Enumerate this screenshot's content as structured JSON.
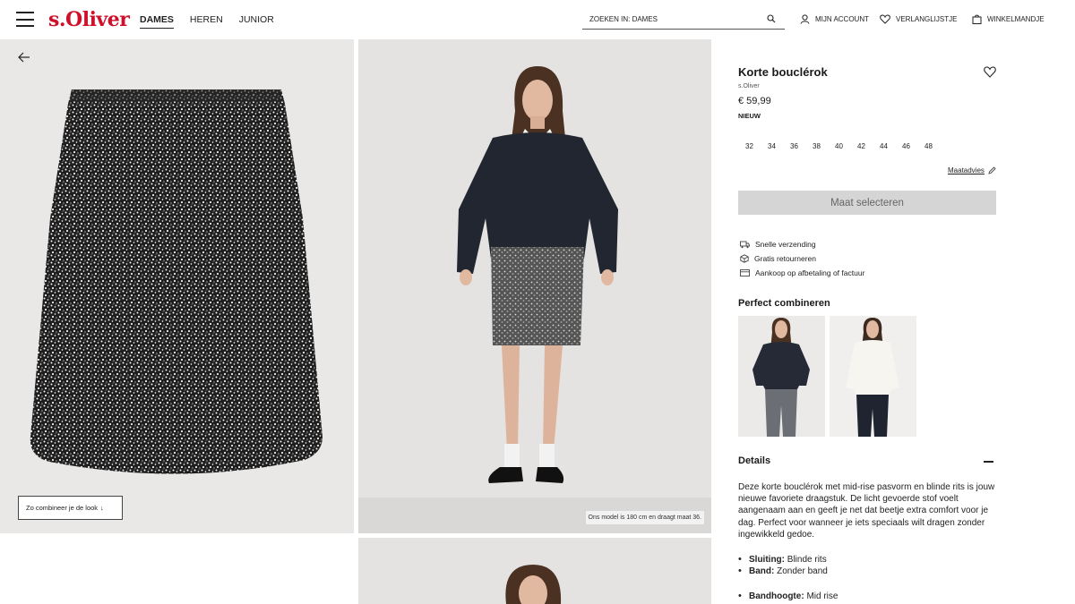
{
  "header": {
    "logo": "s.Oliver",
    "nav": [
      {
        "label": "DAMES",
        "active": true
      },
      {
        "label": "HEREN",
        "active": false
      },
      {
        "label": "JUNIOR",
        "active": false
      }
    ],
    "search_placeholder": "ZOEKEN IN: DAMES",
    "account_label": "MIJN ACCOUNT",
    "wishlist_label": "VERLANGLIJSTJE",
    "cart_label": "WINKELMANDJE"
  },
  "gallery": {
    "look_button": "Zo combineer je de look",
    "model_note": "Ons model is 180 cm en draagt maat 36."
  },
  "product": {
    "title": "Korte bouclérok",
    "brand": "s.Oliver",
    "price": "€ 59,99",
    "badge": "NIEUW",
    "sizes": [
      "32",
      "34",
      "36",
      "38",
      "40",
      "42",
      "44",
      "46",
      "48"
    ],
    "size_advice": "Maatadvies",
    "select_button": "Maat selecteren",
    "usps": [
      {
        "icon": "truck-icon",
        "label": "Snelle verzending"
      },
      {
        "icon": "box-icon",
        "label": "Gratis retourneren"
      },
      {
        "icon": "card-icon",
        "label": "Aankoop op afbetaling of factuur"
      }
    ]
  },
  "combine": {
    "title": "Perfect combineren"
  },
  "details": {
    "title": "Details",
    "description": "Deze korte bouclérok met mid-rise pasvorm en blinde rits is jouw nieuwe favoriete draagstuk. De licht gevoerde stof voelt aangenaam aan en geeft je net dat beetje extra comfort voor je dag. Perfect voor wanneer je iets speciaals wilt dragen zonder ingewikkeld gedoe.",
    "specs": [
      {
        "key": "Sluiting:",
        "value": "Blinde rits"
      },
      {
        "key": "Band:",
        "value": "Zonder band"
      }
    ],
    "specs2": [
      {
        "key": "Bandhoogte:",
        "value": "Mid rise"
      }
    ]
  },
  "colors": {
    "brand_red": "#d0102a",
    "button_disabled": "#d5d5d5"
  }
}
